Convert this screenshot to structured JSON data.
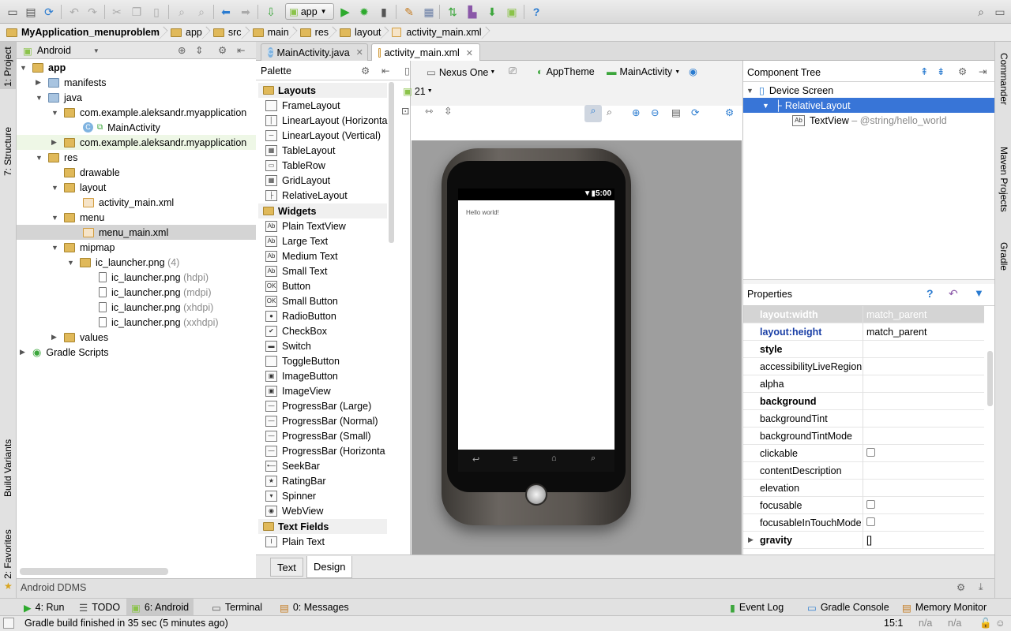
{
  "toolbar": {
    "run_config": "app",
    "icons": [
      "open-icon",
      "save-icon",
      "sync-icon",
      "undo-icon",
      "redo-icon",
      "cut-icon",
      "copy-icon",
      "paste-icon",
      "find-icon",
      "replace-icon",
      "back-icon",
      "forward-icon",
      "make-icon",
      "run-icon",
      "debug-icon",
      "attach-debugger-icon",
      "project-structure-icon",
      "sdk-manager-icon",
      "avd-manager-icon",
      "gradle-sync-icon",
      "ddms-icon",
      "android-icon",
      "help-icon",
      "search-everywhere-icon",
      "hide-icon"
    ]
  },
  "breadcrumb": [
    "MyApplication_menuproblem",
    "app",
    "src",
    "main",
    "res",
    "layout",
    "activity_main.xml"
  ],
  "left_tabs": {
    "project": "1: Project",
    "structure": "7: Structure",
    "build_variants": "Build Variants",
    "favorites": "2: Favorites"
  },
  "right_tabs": {
    "commander": "Commander",
    "maven": "Maven Projects",
    "gradle": "Gradle"
  },
  "project_panel": {
    "view_mode": "Android",
    "tree": [
      {
        "label": "app",
        "bold": true
      },
      {
        "label": "manifests"
      },
      {
        "label": "java"
      },
      {
        "label": "com.example.aleksandr.myapplication"
      },
      {
        "label": "MainActivity"
      },
      {
        "label": "com.example.aleksandr.myapplication"
      },
      {
        "label": "res"
      },
      {
        "label": "drawable"
      },
      {
        "label": "layout"
      },
      {
        "label": "activity_main.xml"
      },
      {
        "label": "menu"
      },
      {
        "label": "menu_main.xml"
      },
      {
        "label": "mipmap"
      },
      {
        "label": "ic_launcher.png",
        "suffix": "(4)"
      },
      {
        "label": "ic_launcher.png",
        "suffix": "(hdpi)"
      },
      {
        "label": "ic_launcher.png",
        "suffix": "(mdpi)"
      },
      {
        "label": "ic_launcher.png",
        "suffix": "(xhdpi)"
      },
      {
        "label": "ic_launcher.png",
        "suffix": "(xxhdpi)"
      },
      {
        "label": "values"
      },
      {
        "label": "Gradle Scripts"
      }
    ]
  },
  "editor_tabs": [
    {
      "label": "MainActivity.java",
      "active": false
    },
    {
      "label": "activity_main.xml",
      "active": true
    }
  ],
  "palette": {
    "title": "Palette",
    "categories": {
      "layouts": "Layouts",
      "widgets": "Widgets",
      "text_fields": "Text Fields"
    },
    "layouts": [
      {
        "label": "FrameLayout",
        "icon": "frame-layout-icon"
      },
      {
        "label": "LinearLayout (Horizonta",
        "icon": "linear-layout-horizontal-icon"
      },
      {
        "label": "LinearLayout (Vertical)",
        "icon": "linear-layout-vertical-icon"
      },
      {
        "label": "TableLayout",
        "icon": "table-layout-icon"
      },
      {
        "label": "TableRow",
        "icon": "table-row-icon"
      },
      {
        "label": "GridLayout",
        "icon": "grid-layout-icon"
      },
      {
        "label": "RelativeLayout",
        "icon": "relative-layout-icon"
      }
    ],
    "widgets": [
      {
        "label": "Plain TextView",
        "icon": "textview-icon",
        "glyph": "Ab"
      },
      {
        "label": "Large Text",
        "icon": "textview-icon",
        "glyph": "Ab"
      },
      {
        "label": "Medium Text",
        "icon": "textview-icon",
        "glyph": "Ab"
      },
      {
        "label": "Small Text",
        "icon": "textview-icon",
        "glyph": "Ab"
      },
      {
        "label": "Button",
        "icon": "button-icon",
        "glyph": "OK"
      },
      {
        "label": "Small Button",
        "icon": "button-icon",
        "glyph": "OK"
      },
      {
        "label": "RadioButton",
        "icon": "radio-button-icon",
        "glyph": "●"
      },
      {
        "label": "CheckBox",
        "icon": "checkbox-icon",
        "glyph": "✔"
      },
      {
        "label": "Switch",
        "icon": "switch-icon",
        "glyph": "▬"
      },
      {
        "label": "ToggleButton",
        "icon": "toggle-button-icon",
        "glyph": ""
      },
      {
        "label": "ImageButton",
        "icon": "image-button-icon",
        "glyph": "▣"
      },
      {
        "label": "ImageView",
        "icon": "image-view-icon",
        "glyph": "▣"
      },
      {
        "label": "ProgressBar (Large)",
        "icon": "progressbar-icon",
        "glyph": "—"
      },
      {
        "label": "ProgressBar (Normal)",
        "icon": "progressbar-icon",
        "glyph": "—"
      },
      {
        "label": "ProgressBar (Small)",
        "icon": "progressbar-icon",
        "glyph": "—"
      },
      {
        "label": "ProgressBar (Horizonta",
        "icon": "progressbar-icon",
        "glyph": "—"
      },
      {
        "label": "SeekBar",
        "icon": "seekbar-icon",
        "glyph": "•—"
      },
      {
        "label": "RatingBar",
        "icon": "ratingbar-icon",
        "glyph": "★"
      },
      {
        "label": "Spinner",
        "icon": "spinner-icon",
        "glyph": "▾"
      },
      {
        "label": "WebView",
        "icon": "webview-icon",
        "glyph": "◉"
      }
    ],
    "text_fields": [
      {
        "label": "Plain Text",
        "icon": "edit-text-icon",
        "glyph": "I"
      }
    ]
  },
  "layout_toolbar": {
    "device": "Nexus One",
    "theme": "AppTheme",
    "activity": "MainActivity",
    "api": "21"
  },
  "device_preview": {
    "time": "5:00",
    "text": "Hello world!"
  },
  "component_tree": {
    "title": "Component Tree",
    "items": [
      {
        "label": "Device Screen"
      },
      {
        "label": "RelativeLayout",
        "selected": true
      },
      {
        "label": "TextView",
        "suffix": "– @string/hello_world"
      }
    ]
  },
  "properties": {
    "title": "Properties",
    "rows": [
      {
        "name": "layout:width",
        "value": "match_parent",
        "style": "selected"
      },
      {
        "name": "layout:height",
        "value": "match_parent",
        "style": "blue-bold"
      },
      {
        "name": "style",
        "value": "",
        "style": "bold"
      },
      {
        "name": "accessibilityLiveRegion",
        "value": ""
      },
      {
        "name": "alpha",
        "value": ""
      },
      {
        "name": "background",
        "value": "",
        "style": "bold"
      },
      {
        "name": "backgroundTint",
        "value": ""
      },
      {
        "name": "backgroundTintMode",
        "value": ""
      },
      {
        "name": "clickable",
        "value": "",
        "checkbox": true
      },
      {
        "name": "contentDescription",
        "value": ""
      },
      {
        "name": "elevation",
        "value": ""
      },
      {
        "name": "focusable",
        "value": "",
        "checkbox": true
      },
      {
        "name": "focusableInTouchMode",
        "value": "",
        "checkbox": true
      },
      {
        "name": "gravity",
        "value": "[]",
        "style": "bold",
        "expandable": true
      }
    ]
  },
  "editor_mode_tabs": {
    "text": "Text",
    "design": "Design"
  },
  "ddms": {
    "title": "Android DDMS"
  },
  "tool_windows": {
    "run": "4: Run",
    "todo": "TODO",
    "android": "6: Android",
    "terminal": "Terminal",
    "messages": "0: Messages",
    "event_log": "Event Log",
    "gradle_console": "Gradle Console",
    "memory_monitor": "Memory Monitor"
  },
  "status": {
    "message": "Gradle build finished in 35 sec (5 minutes ago)",
    "position": "15:1",
    "na1": "n/a",
    "na2": "n/a"
  },
  "colors": {
    "selection": "#3875d7",
    "run_green": "#3ca63c",
    "android_green": "#8bc34a",
    "link_blue": "#1a3fa6"
  }
}
